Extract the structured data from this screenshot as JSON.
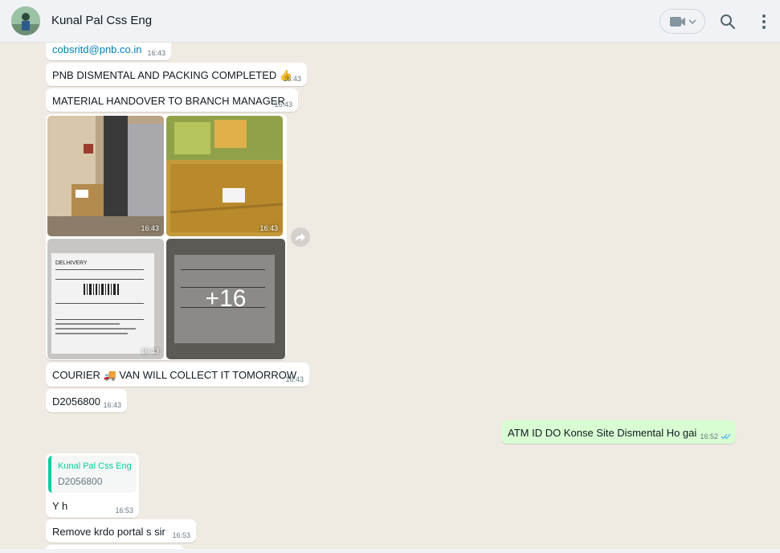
{
  "header": {
    "contact_name": "Kunal Pal Css Eng"
  },
  "messages": {
    "email": {
      "text": "cobsritd@pnb.co.in",
      "time": "16:43"
    },
    "m1": {
      "text": "PNB DISMENTAL AND PACKING COMPLETED 👍",
      "time": "16:43"
    },
    "m2": {
      "text": "MATERIAL HANDOVER TO BRANCH MANAGER",
      "time": "16:43"
    },
    "media": {
      "times": [
        "16:43",
        "16:43",
        "16:43"
      ],
      "more_count": "+16"
    },
    "m3": {
      "text": "COURIER 🚚 VAN WILL COLLECT IT TOMORROW",
      "time": "16:43"
    },
    "m4": {
      "text": "D2056800",
      "time": "16:43"
    },
    "out1": {
      "text": "ATM ID DO Konse Site Dismental Ho gai",
      "time": "16:52"
    },
    "reply": {
      "quoted_name": "Kunal Pal Css Eng",
      "quoted_text": "D2056800",
      "text": "Y h",
      "time": "16:53"
    },
    "m5": {
      "text": "Remove krdo portal s sir",
      "time": "16:53"
    }
  },
  "colors": {
    "chat_bg": "#efeae2",
    "outgoing": "#d9fdd3",
    "read_ticks": "#53bdeb",
    "quote_accent": "#06cf9c"
  },
  "icons": [
    "video-call-icon",
    "chevron-down-icon",
    "search-icon",
    "menu-dots-icon",
    "forward-icon",
    "double-check-icon"
  ]
}
